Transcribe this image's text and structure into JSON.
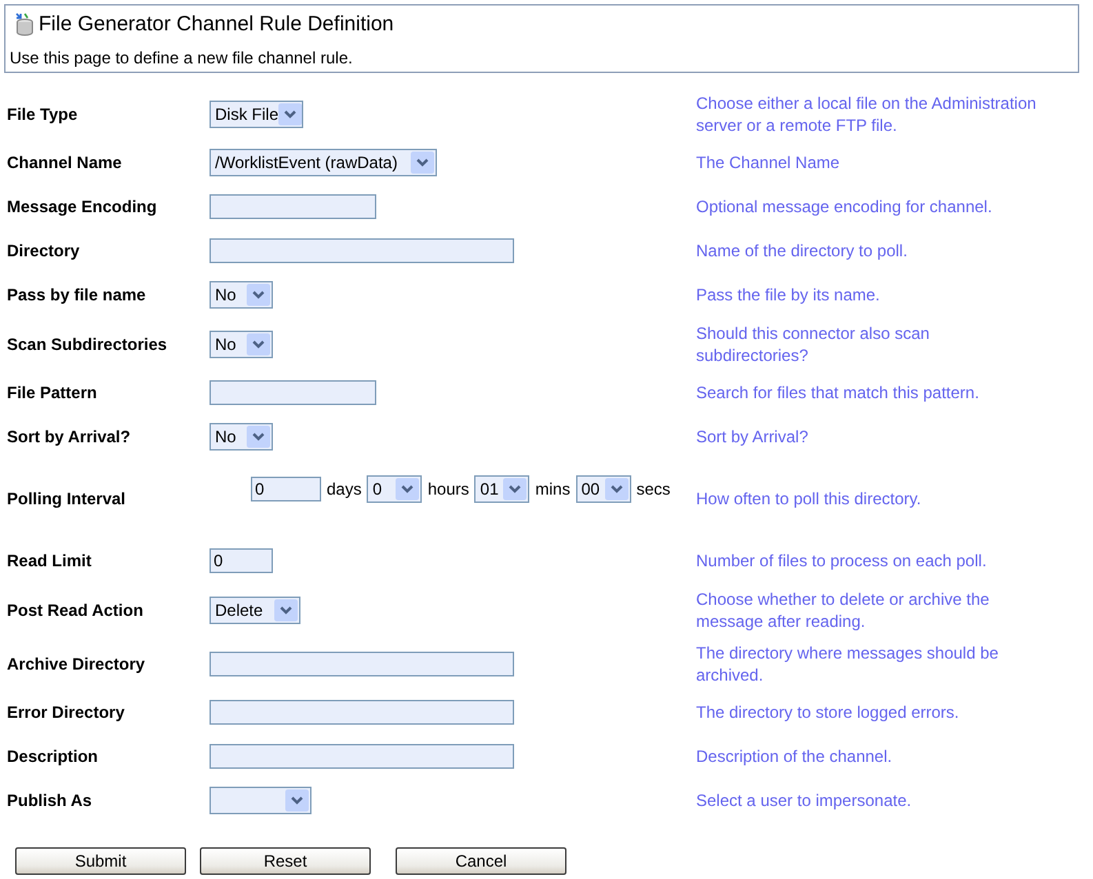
{
  "header": {
    "title": "File Generator Channel Rule Definition",
    "description": "Use this page to define a new file channel rule."
  },
  "rows": [
    {
      "label": "File Type",
      "field": {
        "kind": "select",
        "value": "Disk File"
      },
      "help": "Choose either a local file on the Administration\nserver or a remote FTP file."
    },
    {
      "label": "Channel Name",
      "field": {
        "kind": "select",
        "value": "/WorklistEvent (rawData)"
      },
      "help": "The Channel Name"
    },
    {
      "label": "Message Encoding",
      "field": {
        "kind": "text"
      },
      "help": "Optional message encoding for channel."
    },
    {
      "label": "Directory",
      "field": {
        "kind": "text"
      },
      "help": "Name of the directory to poll."
    },
    {
      "label": "Pass by file name",
      "field": {
        "kind": "select",
        "value": "No"
      },
      "help": "Pass the file by its name."
    },
    {
      "label": "Scan Subdirectories",
      "field": {
        "kind": "select",
        "value": "No"
      },
      "help": "Should this connector also scan\nsubdirectories?"
    },
    {
      "label": "File Pattern",
      "field": {
        "kind": "text"
      },
      "help": "Search for files that match this pattern."
    },
    {
      "label": "Sort by Arrival?",
      "field": {
        "kind": "select",
        "value": "No"
      },
      "help": "Sort by Arrival?"
    },
    {
      "label": "Polling Interval",
      "field": {
        "kind": "interval",
        "parts": [
          {
            "kind": "text",
            "value": "0",
            "unit": "days"
          },
          {
            "kind": "select",
            "value": "0",
            "unit": "hours"
          },
          {
            "kind": "select",
            "value": "01",
            "unit": "mins"
          },
          {
            "kind": "select",
            "value": "00",
            "unit": "secs"
          }
        ]
      },
      "help": "How often to poll this directory."
    },
    {
      "label": "Read Limit",
      "field": {
        "kind": "text",
        "value": "0"
      },
      "help": "Number of files to process on each poll."
    },
    {
      "label": "Post Read Action",
      "field": {
        "kind": "select",
        "value": "Delete"
      },
      "help": "Choose whether to delete or archive the\nmessage after reading."
    },
    {
      "label": "Archive Directory",
      "field": {
        "kind": "text"
      },
      "help": "The directory where messages should be\narchived."
    },
    {
      "label": "Error Directory",
      "field": {
        "kind": "text"
      },
      "help": "The directory to store logged errors."
    },
    {
      "label": "Description",
      "field": {
        "kind": "text"
      },
      "help": "Description of the channel."
    },
    {
      "label": "Publish As",
      "field": {
        "kind": "select"
      },
      "help": "Select a user to impersonate."
    }
  ],
  "buttons": [
    "Submit",
    "Reset",
    "Cancel"
  ]
}
